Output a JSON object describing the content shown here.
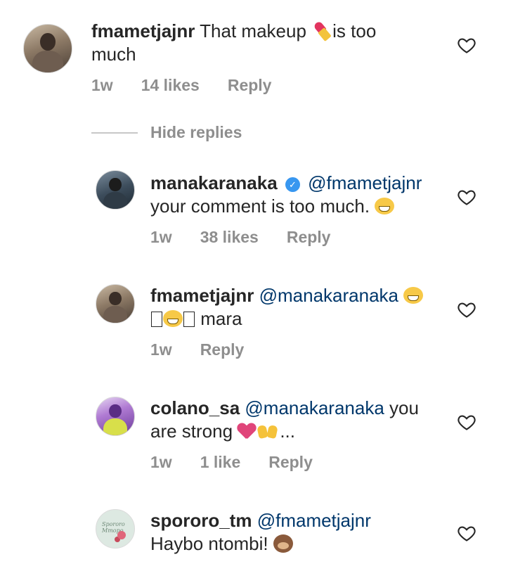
{
  "comments": [
    {
      "username": "fmametjajnr",
      "text_before": "That makeup",
      "text_after": "is too",
      "text_line2": "much",
      "time": "1w",
      "likes": "14 likes",
      "reply": "Reply",
      "emoji_icons": [
        "lipstick-icon"
      ]
    },
    {
      "username": "manakaranaka",
      "verified": true,
      "mention": "@fmametjajnr",
      "text": "your comment is too much.",
      "time": "1w",
      "likes": "38 likes",
      "reply": "Reply",
      "emoji_icons": [
        "grinning-face-icon"
      ]
    },
    {
      "username": "fmametjajnr",
      "mention": "@manakaranaka",
      "text": "mara",
      "time": "1w",
      "reply": "Reply",
      "emoji_icons": [
        "grinning-face-icon",
        "missing-glyph-box",
        "grinning-face-icon",
        "missing-glyph-box"
      ]
    },
    {
      "username": "colano_sa",
      "mention": "@manakaranaka",
      "text_line1_after": "you",
      "text_line2": "are strong",
      "ellipsis": "...",
      "time": "1w",
      "likes": "1 like",
      "reply": "Reply",
      "emoji_icons": [
        "heart-icon",
        "raised-hands-icon"
      ]
    },
    {
      "username": "spororo_tm",
      "mention": "@fmametjajnr",
      "text": "Haybo ntombi!",
      "emoji_icons": [
        "see-no-evil-monkey-icon"
      ]
    }
  ],
  "hide_replies": "Hide replies",
  "avatar_scribble": "Spororo Mmopo",
  "colors": {
    "text": "#262626",
    "meta": "#8e8e8e",
    "mention": "#00376b",
    "verified": "#3897f0",
    "divider": "#c7c7c7"
  }
}
